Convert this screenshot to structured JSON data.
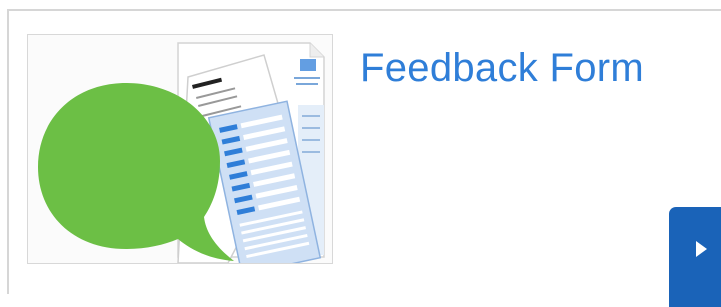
{
  "card": {
    "title": "Feedback Form",
    "thumbnail_icon": "feedback-speech-bubble-with-form-pages",
    "action_icon": "play-arrow-icon"
  },
  "colors": {
    "title": "#2f7ed8",
    "speech_bubble": "#6cbf45",
    "form_accent": "#2f7ed8",
    "action_button": "#1a63b8"
  }
}
